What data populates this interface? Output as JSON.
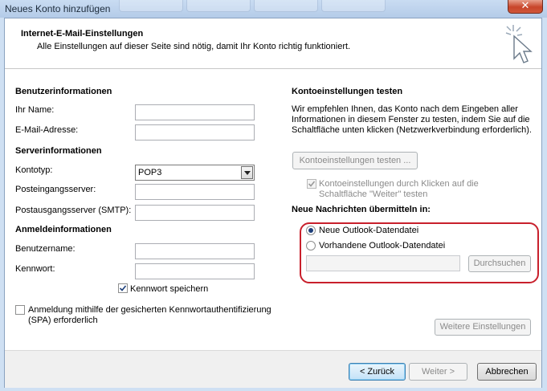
{
  "window": {
    "title": "Neues Konto hinzufügen",
    "close_glyph": "✕"
  },
  "header": {
    "title": "Internet-E-Mail-Einstellungen",
    "subtitle": "Alle Einstellungen auf dieser Seite sind nötig, damit Ihr Konto richtig funktioniert.",
    "icon": "cursor-sparkle-icon"
  },
  "user_info": {
    "heading": "Benutzerinformationen",
    "name_label": "Ihr Name:",
    "name_value": "",
    "email_label": "E-Mail-Adresse:",
    "email_value": ""
  },
  "server_info": {
    "heading": "Serverinformationen",
    "account_type_label": "Kontotyp:",
    "account_type_value": "POP3",
    "incoming_label": "Posteingangsserver:",
    "incoming_value": "",
    "outgoing_label": "Postausgangsserver (SMTP):",
    "outgoing_value": ""
  },
  "login_info": {
    "heading": "Anmeldeinformationen",
    "username_label": "Benutzername:",
    "username_value": "",
    "password_label": "Kennwort:",
    "password_value": "",
    "remember_password_label": "Kennwort speichern",
    "remember_password_checked": true,
    "spa_label_line1": "Anmeldung mithilfe der gesicherten Kennwortauthentifizierung",
    "spa_label_line2": "(SPA) erforderlich",
    "spa_checked": false
  },
  "test_settings": {
    "heading": "Kontoeinstellungen testen",
    "description_line1": "Wir empfehlen Ihnen, das Konto nach dem Eingeben aller",
    "description_line2": "Informationen in diesem Fenster zu testen, indem Sie auf die",
    "description_line3": "Schaltfläche unten klicken (Netzwerkverbindung erforderlich).",
    "test_button": "Kontoeinstellungen testen ...",
    "auto_test_label_line1": "Kontoeinstellungen durch Klicken auf die",
    "auto_test_label_line2": "Schaltfläche \"Weiter\" testen",
    "auto_test_checked": true
  },
  "deliver": {
    "heading": "Neue Nachrichten übermitteln in:",
    "option_new": "Neue Outlook-Datendatei",
    "option_existing": "Vorhandene Outlook-Datendatei",
    "selected": "new",
    "path_value": "",
    "browse_button": "Durchsuchen"
  },
  "more_settings_button": "Weitere Einstellungen",
  "footer": {
    "back": "< Zurück",
    "next": "Weiter >",
    "cancel": "Abbrechen"
  },
  "colors": {
    "highlight_border": "#c8202c",
    "radio_dot": "#1d3f7a",
    "default_button_border": "#3c7fb1"
  }
}
